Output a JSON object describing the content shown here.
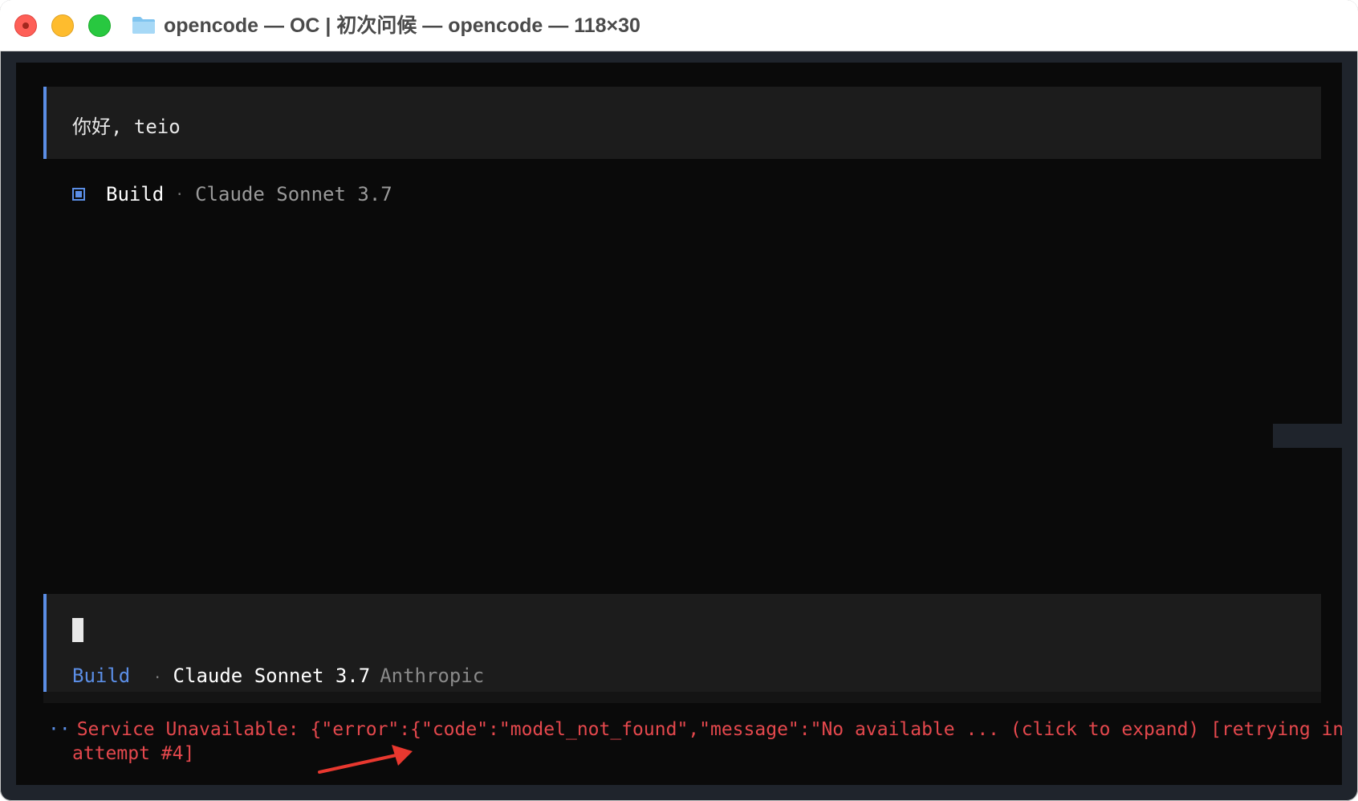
{
  "window": {
    "title": "opencode — OC | 初次问候 — opencode — 118×30"
  },
  "conversation": {
    "user_message": "你好, teio",
    "agent": {
      "name": "Build",
      "separator": "·",
      "model": "Claude Sonnet 3.7"
    }
  },
  "input": {
    "value": "",
    "status": {
      "agent": "Build",
      "separator": "·",
      "model": "Claude Sonnet 3.7",
      "provider": "Anthropic"
    }
  },
  "error": {
    "prefix": "··",
    "line1": "Service Unavailable: {\"error\":{\"code\":\"model_not_found\",\"message\":\"No available ... (click to expand) [retrying in",
    "line2": "attempt #4]"
  },
  "colors": {
    "accent": "#5b8ee6",
    "error": "#e5484d",
    "annotation_arrow": "#e8382f"
  }
}
